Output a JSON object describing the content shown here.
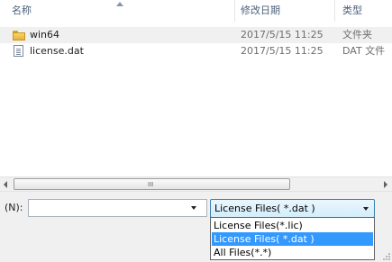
{
  "columns": {
    "name": "名称",
    "modified": "修改日期",
    "type": "类型"
  },
  "files": [
    {
      "name": "win64",
      "modified": "2017/5/15 11:25",
      "type": "文件夹",
      "icon": "folder-icon"
    },
    {
      "name": "license.dat",
      "modified": "2017/5/15 11:25",
      "type": "DAT 文件",
      "icon": "file-icon"
    }
  ],
  "scrollbar": {
    "grip": "III"
  },
  "filename": {
    "label": "(N):",
    "value": ""
  },
  "filter": {
    "selected": "License Files( *.dat )",
    "options": [
      "License Files(*.lic)",
      "License Files( *.dat )",
      "All Files(*.*)"
    ],
    "highlighted_index": 1
  },
  "colors": {
    "selection": "#3399ff",
    "header_text": "#4c607a"
  }
}
